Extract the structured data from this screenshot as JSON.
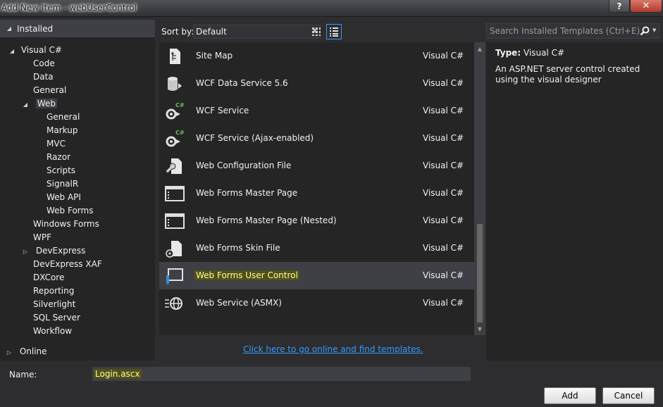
{
  "window": {
    "title": "Add New Item - webUserControl",
    "help_label": "?",
    "close_label": "✕"
  },
  "sidebar": {
    "installed_label": "Installed",
    "root_label": "Visual C#",
    "items": [
      "Code",
      "Data",
      "General",
      "Web"
    ],
    "web_children": [
      "General",
      "Markup",
      "MVC",
      "Razor",
      "Scripts",
      "SignalR",
      "Web API",
      "Web Forms"
    ],
    "more_items": [
      "Windows Forms",
      "WPF",
      "DevExpress",
      "DevExpress XAF",
      "DXCore",
      "Reporting",
      "Silverlight",
      "SQL Server",
      "Workflow"
    ],
    "online_label": "Online"
  },
  "toolbar": {
    "sort_label": "Sort by:",
    "sort_value": "Default"
  },
  "templates": [
    {
      "name": "Site Map",
      "lang": "Visual C#",
      "icon": "sitemap-icon"
    },
    {
      "name": "WCF Data Service 5.6",
      "lang": "Visual C#",
      "icon": "data-service-icon"
    },
    {
      "name": "WCF Service",
      "lang": "Visual C#",
      "icon": "wcf-service-icon"
    },
    {
      "name": "WCF Service (Ajax-enabled)",
      "lang": "Visual C#",
      "icon": "wcf-ajax-icon"
    },
    {
      "name": "Web Configuration File",
      "lang": "Visual C#",
      "icon": "config-file-icon"
    },
    {
      "name": "Web Forms Master Page",
      "lang": "Visual C#",
      "icon": "master-page-icon"
    },
    {
      "name": "Web Forms Master Page (Nested)",
      "lang": "Visual C#",
      "icon": "master-page-nested-icon"
    },
    {
      "name": "Web Forms Skin File",
      "lang": "Visual C#",
      "icon": "skin-file-icon"
    },
    {
      "name": "Web Forms User Control",
      "lang": "Visual C#",
      "icon": "user-control-icon"
    },
    {
      "name": "Web Service (ASMX)",
      "lang": "Visual C#",
      "icon": "web-service-icon"
    }
  ],
  "online_link": "Click here to go online and find templates.",
  "search": {
    "placeholder": "Search Installed Templates (Ctrl+E)"
  },
  "details": {
    "type_label": "Type:",
    "type_value": "Visual C#",
    "description": "An ASP.NET server control created using the visual designer"
  },
  "form": {
    "name_label": "Name:",
    "name_value": "Login.ascx",
    "add_label": "Add",
    "cancel_label": "Cancel"
  }
}
